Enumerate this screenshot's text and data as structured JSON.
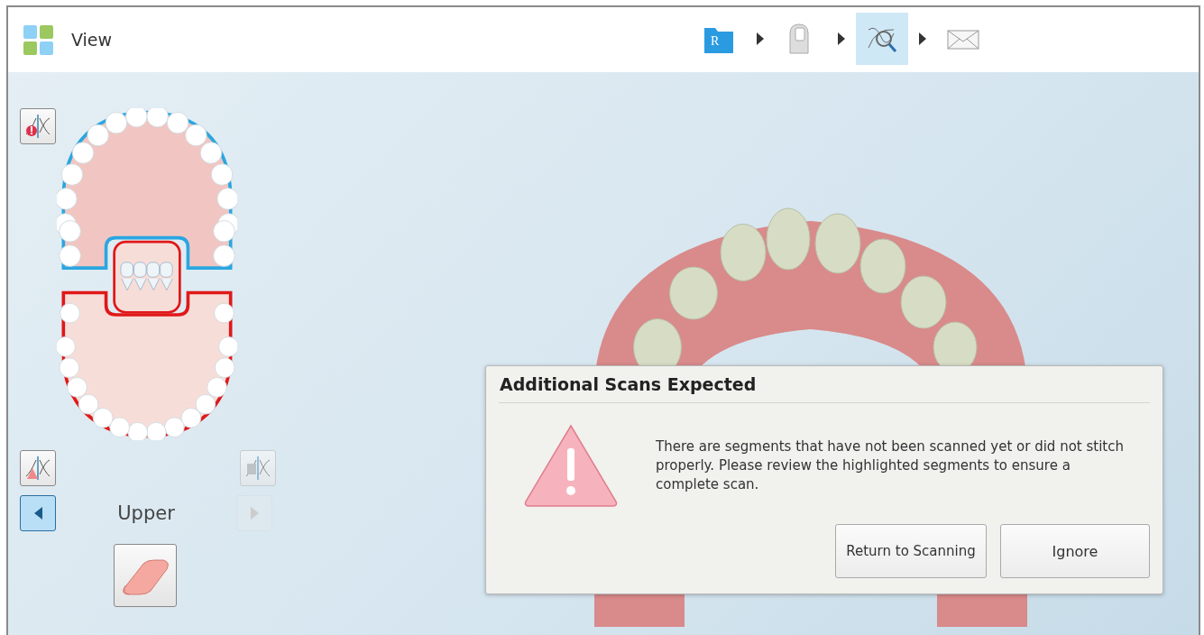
{
  "header": {
    "title": "View"
  },
  "workflow_steps": [
    {
      "kind": "rx",
      "glyph": "R",
      "selected": false
    },
    {
      "kind": "scan",
      "selected": false
    },
    {
      "kind": "view",
      "selected": true
    },
    {
      "kind": "send",
      "selected": false
    }
  ],
  "jaw_panel": {
    "segment_label": "Upper",
    "previous_disabled": false,
    "next_disabled": true
  },
  "dialog": {
    "title": "Additional Scans Expected",
    "message": "There are segments that have not been scanned yet or did not stitch properly. Please review the highlighted segments to ensure a complete scan.",
    "buttons": [
      "Return to Scanning",
      "Ignore"
    ]
  }
}
